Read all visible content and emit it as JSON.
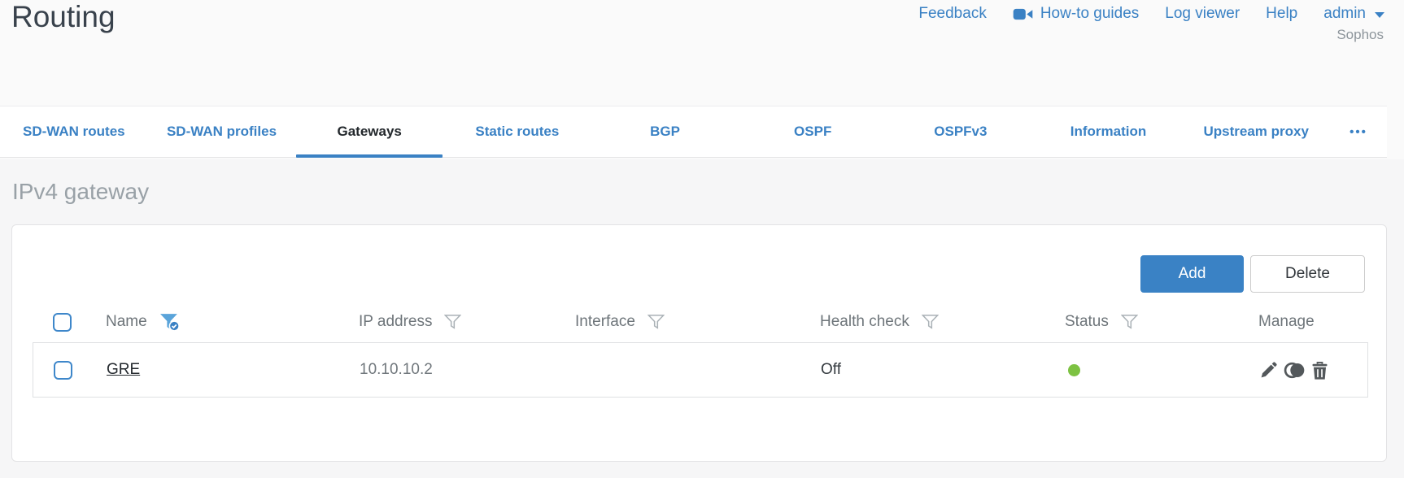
{
  "page": {
    "title": "Routing",
    "vendor": "Sophos"
  },
  "header": {
    "feedback": "Feedback",
    "howto": "How-to guides",
    "logviewer": "Log viewer",
    "help": "Help",
    "user": "admin"
  },
  "tabs": {
    "items": [
      "SD-WAN routes",
      "SD-WAN profiles",
      "Gateways",
      "Static routes",
      "BGP",
      "OSPF",
      "OSPFv3",
      "Information",
      "Upstream proxy"
    ],
    "active": "Gateways",
    "more": "•••"
  },
  "section": {
    "title": "IPv4 gateway"
  },
  "toolbar": {
    "add_label": "Add",
    "delete_label": "Delete"
  },
  "table": {
    "columns": {
      "name": "Name",
      "ip": "IP address",
      "interface": "Interface",
      "health": "Health check",
      "status": "Status",
      "manage": "Manage"
    },
    "filters": {
      "name": "active",
      "ip": "inactive",
      "interface": "inactive",
      "health": "inactive",
      "status": "inactive"
    },
    "rows": [
      {
        "name": "GRE",
        "ip": "10.10.10.2",
        "interface": "",
        "health": "Off",
        "status": "up"
      }
    ]
  },
  "colors": {
    "accent_blue": "#3a81c4",
    "filter_active_blue": "#5aa4da",
    "status_up_green": "#7dc242",
    "panel_border": "#e3e3e5",
    "header_text_gray": "#6e757a"
  }
}
